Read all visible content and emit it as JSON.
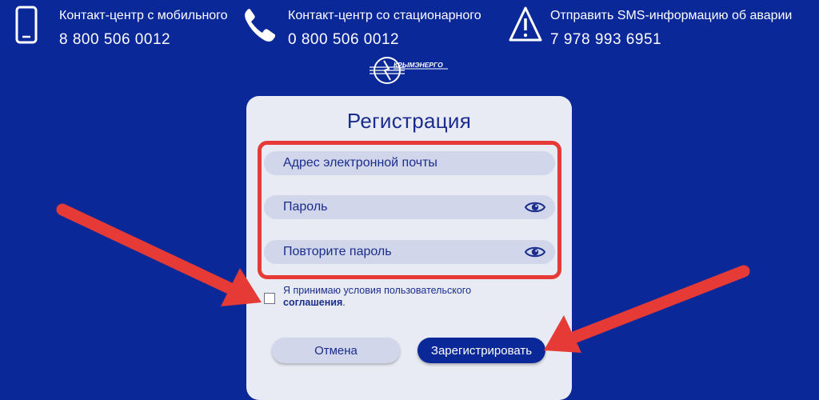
{
  "header": {
    "contacts": [
      {
        "title": "Контакт-центр с мобильного",
        "phone": "8 800 506 0012",
        "icon": "mobile-phone-icon"
      },
      {
        "title": "Контакт-центр со стационарного",
        "phone": "0 800 506 0012",
        "icon": "landline-phone-icon"
      },
      {
        "title": "Отправить SMS-информацию об аварии",
        "phone": "7 978 993 6951",
        "icon": "warning-triangle-icon"
      }
    ],
    "logo_text": "КРЫМЭНЕРГО"
  },
  "form": {
    "title": "Регистрация",
    "email_placeholder": "Адрес электронной почты",
    "password_placeholder": "Пароль",
    "password_repeat_placeholder": "Повторите пароль",
    "agree_text": "Я принимаю условия пользовательского",
    "agree_link": "соглашения",
    "agree_end": ".",
    "cancel_label": "Отмена",
    "register_label": "Зарегистрировать"
  },
  "colors": {
    "background": "#0a2898",
    "card": "#e9ebf4",
    "field": "#d1d6ea",
    "accent_text": "#1a2d8c",
    "annotation": "#e53a35"
  }
}
